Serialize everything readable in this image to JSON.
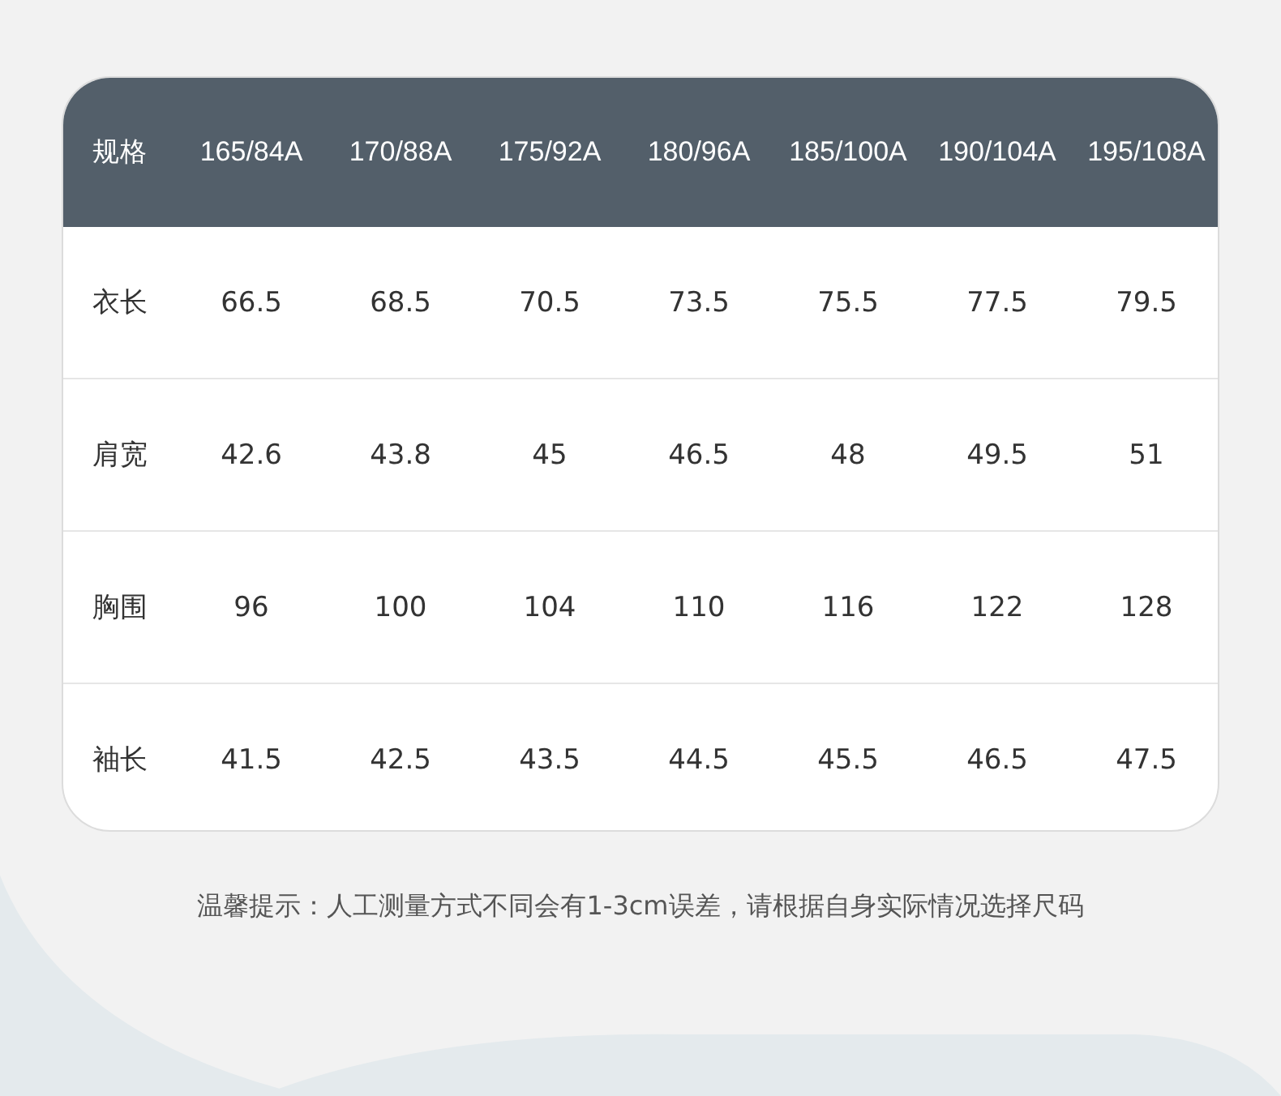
{
  "table": {
    "columns": [
      "规格",
      "165/84A",
      "170/88A",
      "175/92A",
      "180/96A",
      "185/100A",
      "190/104A",
      "195/108A"
    ],
    "rows": [
      {
        "name": "衣长",
        "values": [
          "66.5",
          "68.5",
          "70.5",
          "73.5",
          "75.5",
          "77.5",
          "79.5"
        ]
      },
      {
        "name": "肩宽",
        "values": [
          "42.6",
          "43.8",
          "45",
          "46.5",
          "48",
          "49.5",
          "51"
        ]
      },
      {
        "name": "胸围",
        "values": [
          "96",
          "100",
          "104",
          "110",
          "116",
          "122",
          "128"
        ]
      },
      {
        "name": "袖长",
        "values": [
          "41.5",
          "42.5",
          "43.5",
          "44.5",
          "45.5",
          "46.5",
          "47.5"
        ]
      }
    ]
  },
  "note": "温馨提示：人工测量方式不同会有1-3cm误差，请根据自身实际情况选择尺码"
}
